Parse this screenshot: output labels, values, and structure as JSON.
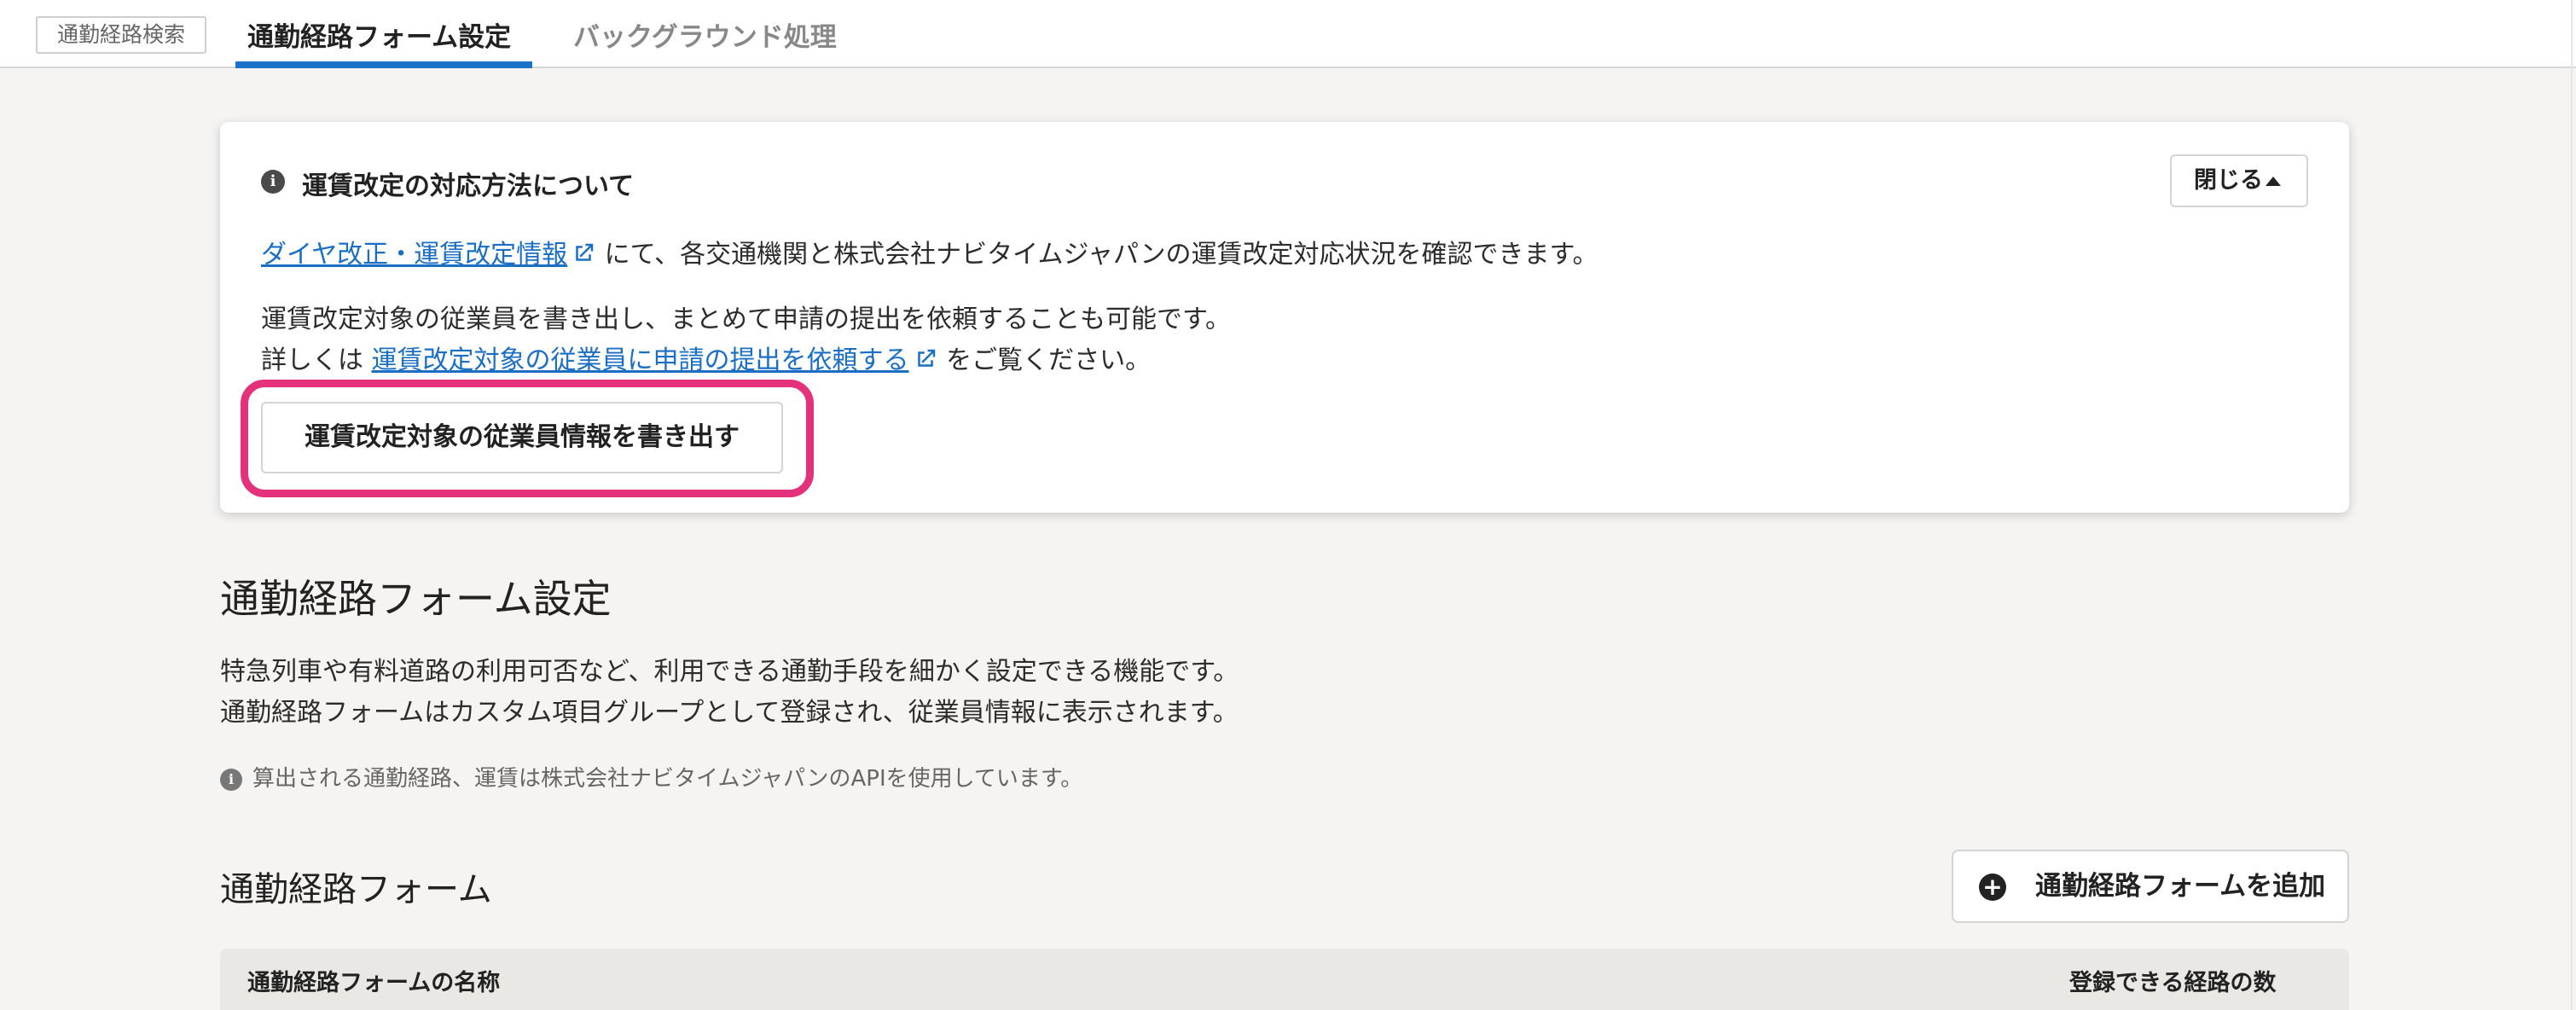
{
  "tabs": {
    "badge": "通勤経路検索",
    "items": [
      {
        "label": "通勤経路フォーム設定",
        "active": true
      },
      {
        "label": "バックグラウンド処理",
        "active": false
      }
    ]
  },
  "notice": {
    "title": "運賃改定の対応方法について",
    "close_label": "閉じる",
    "line1_link": "ダイヤ改正・運賃改定情報",
    "line1_text": "にて、各交通機関と株式会社ナビタイムジャパンの運賃改定対応状況を確認できます。",
    "line2": "運賃改定対象の従業員を書き出し、まとめて申請の提出を依頼することも可能です。",
    "line3_prefix": "詳しくは",
    "line3_link": "運賃改定対象の従業員に申請の提出を依頼する",
    "line3_suffix": "をご覧ください。",
    "export_button": "運賃改定対象の従業員情報を書き出す"
  },
  "main": {
    "title": "通勤経路フォーム設定",
    "desc1": "特急列車や有料道路の利用可否など、利用できる通勤手段を細かく設定できる機能です。",
    "desc2": "通勤経路フォームはカスタム項目グループとして登録され、従業員情報に表示されます。",
    "api_note": "算出される通勤経路、運賃は株式会社ナビタイムジャパンのAPIを使用しています。"
  },
  "forms": {
    "title": "通勤経路フォーム",
    "add_button": "通勤経路フォームを追加",
    "columns": [
      "通勤経路フォームの名称",
      "登録できる経路の数"
    ]
  },
  "colors": {
    "link": "#1a6fc4",
    "highlight": "#e5317c",
    "tab_underline": "#1a73c8"
  }
}
